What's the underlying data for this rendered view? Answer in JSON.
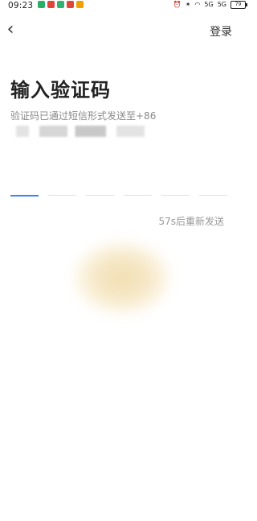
{
  "status_bar": {
    "time": "09:23",
    "app_icons": [
      {
        "name": "wechat-icon",
        "color": "#2aae67"
      },
      {
        "name": "red-app-icon",
        "color": "#e0453a"
      },
      {
        "name": "green-app-icon",
        "color": "#2fb36e"
      },
      {
        "name": "red-app-icon-2",
        "color": "#e0453a"
      },
      {
        "name": "weibo-icon",
        "color": "#f2a000"
      }
    ],
    "signal_left": "5G",
    "signal_right": "5G",
    "battery": "79"
  },
  "header": {
    "back_icon": "chevron-left-icon",
    "login_label": "登录"
  },
  "main": {
    "title": "输入验证码",
    "subtitle": "验证码已通过短信形式发送至+86",
    "resend_text": "57s后重新发送",
    "code_slots": 6,
    "active_slot": 0,
    "accent_color": "#3b82f6"
  }
}
